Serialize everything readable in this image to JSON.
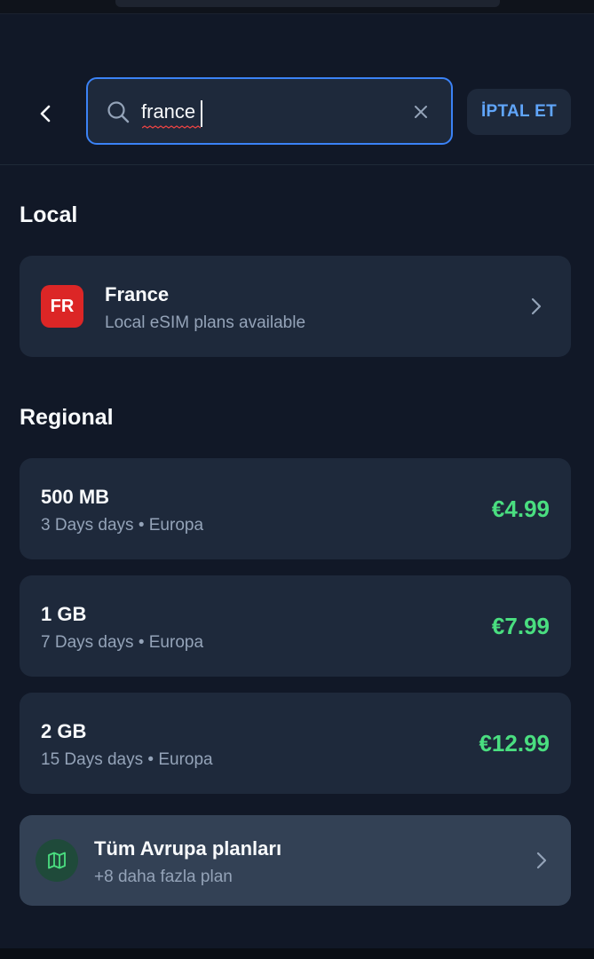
{
  "header": {
    "search_value": "france",
    "cancel_label": "İPTAL ET"
  },
  "local": {
    "title": "Local",
    "items": [
      {
        "flag_code": "FR",
        "name": "France",
        "subtitle": "Local eSIM plans available"
      }
    ]
  },
  "regional": {
    "title": "Regional",
    "plans": [
      {
        "data": "500 MB",
        "duration": "3 Days days • Europa",
        "price": "€4.99"
      },
      {
        "data": "1 GB",
        "duration": "7 Days days • Europa",
        "price": "€7.99"
      },
      {
        "data": "2 GB",
        "duration": "15 Days days • Europa",
        "price": "€12.99"
      }
    ]
  },
  "all_plans": {
    "title": "Tüm Avrupa planları",
    "subtitle": "+8 daha fazla plan",
    "icon": "map-icon"
  },
  "colors": {
    "background": "#111827",
    "card": "#1e293b",
    "accent": "#3b82f6",
    "price": "#4ade80",
    "flag": "#dc2626"
  }
}
